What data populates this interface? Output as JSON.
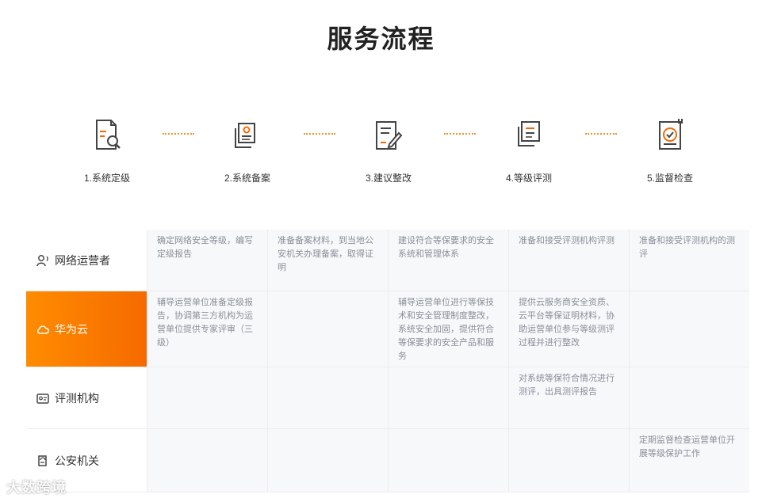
{
  "page": {
    "title": "服务流程"
  },
  "steps": [
    {
      "label": "1.系统定级",
      "icon": "document-search-icon"
    },
    {
      "label": "2.系统备案",
      "icon": "files-stack-icon"
    },
    {
      "label": "3.建议整改",
      "icon": "document-edit-icon"
    },
    {
      "label": "4.等级评测",
      "icon": "documents-review-icon"
    },
    {
      "label": "5.监督检查",
      "icon": "certificate-check-icon"
    }
  ],
  "colors": {
    "accent": "#f56a00",
    "accent_light": "#ff8c00",
    "dots": "#f0912a",
    "cell_bg": "#f7f8fa"
  },
  "roles": [
    {
      "name": "网络运营者",
      "icon": "user-voice-icon",
      "active": false,
      "cells": [
        "确定网络安全等级，编写定级报告",
        "准备备案材料，到当地公安机关办理备案，取得证明",
        "建设符合等保要求的安全系统和管理体系",
        "准备和接受评测机构评测",
        "准备和接受评测机构的测评"
      ]
    },
    {
      "name": "华为云",
      "icon": "cloud-icon",
      "active": true,
      "cells": [
        "辅导运营单位准备定级报告，协调第三方机构为运营单位提供专家评审（三级）",
        "",
        "辅导运营单位进行等保技术和安全管理制度整改，系统安全加固，提供符合等保要求的安全产品和服务",
        "提供云服务商安全资质、云平台等保证明材料，协助运营单位参与等级测评过程并进行整改",
        ""
      ]
    },
    {
      "name": "评测机构",
      "icon": "id-card-icon",
      "active": false,
      "cells": [
        "",
        "",
        "",
        "对系统等保符合情况进行测评，出具测评报告",
        ""
      ]
    },
    {
      "name": "公安机关",
      "icon": "police-badge-icon",
      "active": false,
      "cells": [
        "",
        "",
        "",
        "",
        "定期监督检查运营单位开展等级保护工作"
      ]
    }
  ],
  "watermark": "大数跨境"
}
